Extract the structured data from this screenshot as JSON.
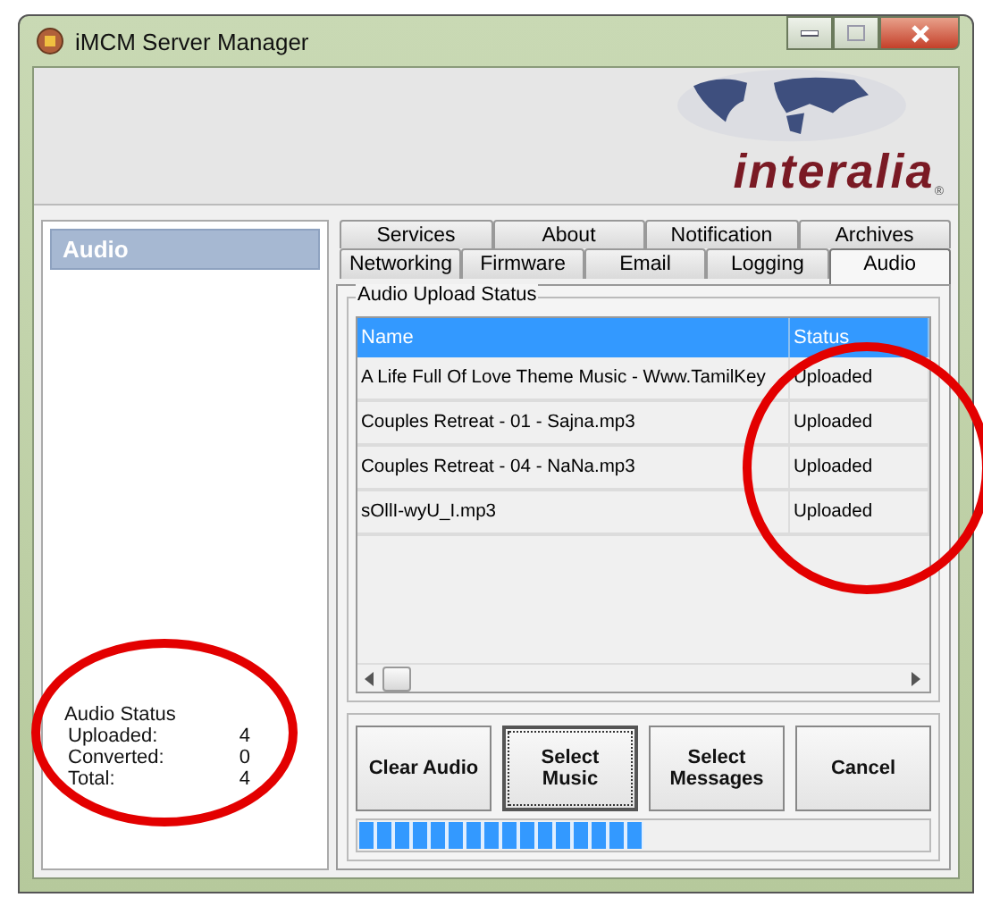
{
  "window": {
    "title": "iMCM Server Manager"
  },
  "banner": {
    "logo_text": "interalia",
    "logo_mark": "®"
  },
  "sidebar": {
    "title": "Audio",
    "status_title": "Audio Status",
    "stats": [
      {
        "label": "Uploaded:",
        "value": "4"
      },
      {
        "label": "Converted:",
        "value": "0"
      },
      {
        "label": "Total:",
        "value": "4"
      }
    ]
  },
  "tab_rows": [
    [
      {
        "label": "Services",
        "selected": false
      },
      {
        "label": "About",
        "selected": false
      },
      {
        "label": "Notification",
        "selected": false
      },
      {
        "label": "Archives",
        "selected": false
      }
    ],
    [
      {
        "label": "Networking",
        "selected": false
      },
      {
        "label": "Firmware",
        "selected": false
      },
      {
        "label": "Email",
        "selected": false
      },
      {
        "label": "Logging",
        "selected": false
      },
      {
        "label": "Audio",
        "selected": true
      }
    ]
  ],
  "group": {
    "title": "Audio Upload Status"
  },
  "table": {
    "columns": [
      "Name",
      "Status"
    ],
    "rows": [
      [
        "A Life Full Of Love Theme Music - Www.TamilKey",
        "Uploaded"
      ],
      [
        "Couples Retreat - 01 - Sajna.mp3",
        "Uploaded"
      ],
      [
        "Couples Retreat - 04 - NaNa.mp3",
        "Uploaded"
      ],
      [
        "sOllI-wyU_I.mp3",
        "Uploaded"
      ]
    ]
  },
  "buttons": [
    {
      "label": "Clear Audio",
      "focused": false
    },
    {
      "label": "Select\nMusic",
      "focused": true
    },
    {
      "label": "Select\nMessages",
      "focused": false
    },
    {
      "label": "Cancel",
      "focused": false
    }
  ],
  "progress": {
    "level": 0.5
  }
}
